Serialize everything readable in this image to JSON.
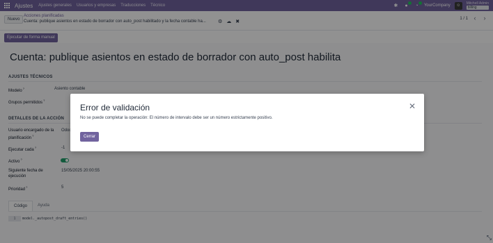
{
  "navbar": {
    "brand": "Ajustes",
    "menu": [
      "Ajustes generales",
      "Usuarios y empresas",
      "Traducciones",
      "Técnico"
    ],
    "company": "YourCompany",
    "user_name": "Mitchell Admin",
    "db_name": "billing"
  },
  "control": {
    "new_label": "Nuevo",
    "breadcrumb_parent": "Acciones planificadas",
    "breadcrumb_current": "Cuenta: publique asientos en estado de borrador con auto_post habilitado y la fecha contable ha...",
    "pager": "1 / 1"
  },
  "action": {
    "run_manual_label": "Ejecutar de forma manual"
  },
  "form": {
    "title": "Cuenta: publique asientos en estado de borrador con auto_post habilitado y la fecha contable ha llegado",
    "section_technical": "AJUSTES TÉCNICOS",
    "model_label": "Modelo",
    "model_value": "Asiento contable",
    "groups_label": "Grupos permitidos",
    "section_action": "DETALLES DE LA ACCIÓN",
    "user_label": "Usuario encargado de la planificación",
    "user_value": "OdooBot",
    "interval_label": "Ejecutar cada",
    "interval_value": "-1",
    "active_label": "Activo",
    "active": true,
    "next_label": "Siguiente fecha de ejecución",
    "next_value": "15/05/2025 20:00:55",
    "priority_label": "Prioridad",
    "priority_value": "5",
    "tab_code": "Código",
    "tab_help": "Ayuda",
    "code_line_no": "1",
    "code_line": "model._autopost_draft_entries()"
  },
  "modal": {
    "title": "Error de validación",
    "message": "No se puede completar la operación: El número de intervalo debe ser un número estrictamente positivo.",
    "close_button": "Cerrar"
  },
  "colors": {
    "brand": "#71639e",
    "toggle_on": "#22a06b"
  },
  "icons": [
    "apps-grid-icon",
    "chat-icon",
    "activity-clock-icon",
    "gear-icon",
    "cloud-upload-icon",
    "discard-x-icon",
    "chevron-left-icon",
    "chevron-right-icon",
    "close-icon",
    "resize-icon"
  ]
}
